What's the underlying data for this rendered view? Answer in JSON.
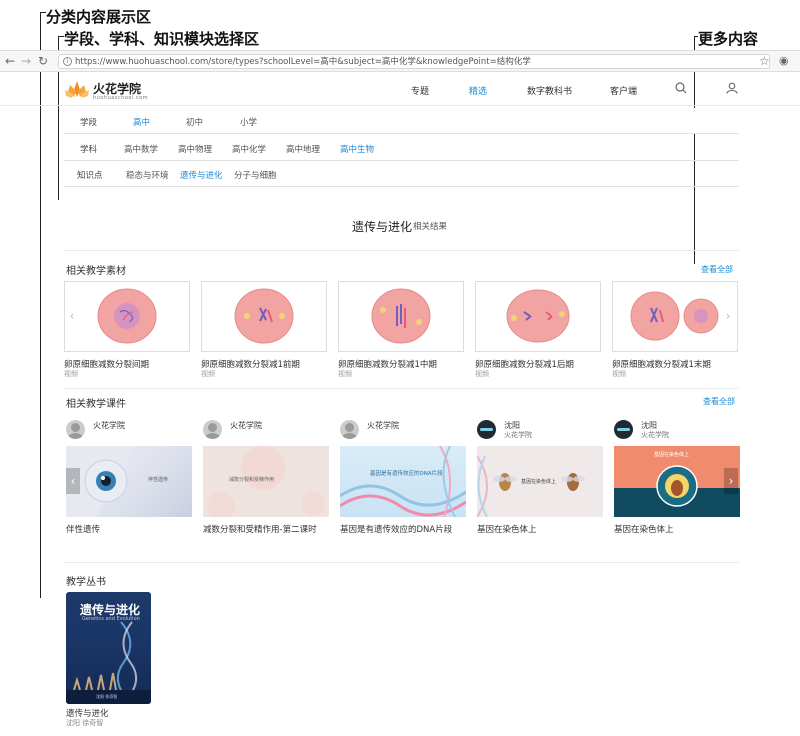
{
  "annotations": {
    "category_area": "分类内容展示区",
    "filter_area": "学段、学科、知识模块选择区",
    "more_content": "更多内容"
  },
  "browser": {
    "url": "https://www.huohuaschool.com/store/types?schoolLevel=高中&subject=高中化学&knowledgePoint=结构化学"
  },
  "site": {
    "logo": "火花学院",
    "logo_sub": "huohuaschool.com",
    "nav": [
      {
        "label": "专题",
        "active": false
      },
      {
        "label": "精选",
        "active": true
      },
      {
        "label": "数字教科书",
        "active": false
      },
      {
        "label": "客户端",
        "active": false
      }
    ]
  },
  "filters": {
    "level": {
      "label": "学段",
      "options": [
        "高中",
        "初中",
        "小学"
      ],
      "active": "高中"
    },
    "subject": {
      "label": "学科",
      "options": [
        "高中数学",
        "高中物理",
        "高中化学",
        "高中地理",
        "高中生物"
      ],
      "active": "高中生物"
    },
    "knowledge": {
      "label": "知识点",
      "options": [
        "稳态与环境",
        "遗传与进化",
        "分子与细胞"
      ],
      "active": "遗传与进化"
    }
  },
  "result": {
    "title": "遗传与进化",
    "subtitle": "相关结果"
  },
  "materials": {
    "title": "相关教学素材",
    "see_all": "查看全部",
    "items": [
      {
        "title": "卵原细胞减数分裂间期",
        "type": "视频"
      },
      {
        "title": "卵原细胞减数分裂减1前期",
        "type": "视频"
      },
      {
        "title": "卵原细胞减数分裂减1中期",
        "type": "视频"
      },
      {
        "title": "卵原细胞减数分裂减1后期",
        "type": "视频"
      },
      {
        "title": "卵原细胞减数分裂减1末期",
        "type": "视频"
      }
    ]
  },
  "courseware": {
    "title": "相关教学课件",
    "see_all": "查看全部",
    "items": [
      {
        "author": "火花学院",
        "author_sub": "",
        "title": "伴性遗传",
        "slide_text": "伴性遗传"
      },
      {
        "author": "火花学院",
        "author_sub": "",
        "title": "减数分裂和受精作用-第二课时",
        "slide_text": "减数分裂和受精作用"
      },
      {
        "author": "火花学院",
        "author_sub": "",
        "title": "基因是有遗传效应的DNA片段",
        "slide_text": "基因是有遗传效应的DNA片段"
      },
      {
        "author": "沈阳",
        "author_sub": "火花学院",
        "title": "基因在染色体上",
        "slide_text": "基因在染色体上"
      },
      {
        "author": "沈阳",
        "author_sub": "火花学院",
        "title": "基因在染色体上",
        "slide_text": "基因在染色体上"
      }
    ]
  },
  "books": {
    "title": "教学丛书",
    "items": [
      {
        "title": "遗传与进化",
        "author": "沈阳 徐奇智",
        "cover_title": "遗传与进化",
        "cover_sub": "Genetics and Evolution"
      }
    ]
  },
  "colors": {
    "accent": "#1a8ad6"
  }
}
